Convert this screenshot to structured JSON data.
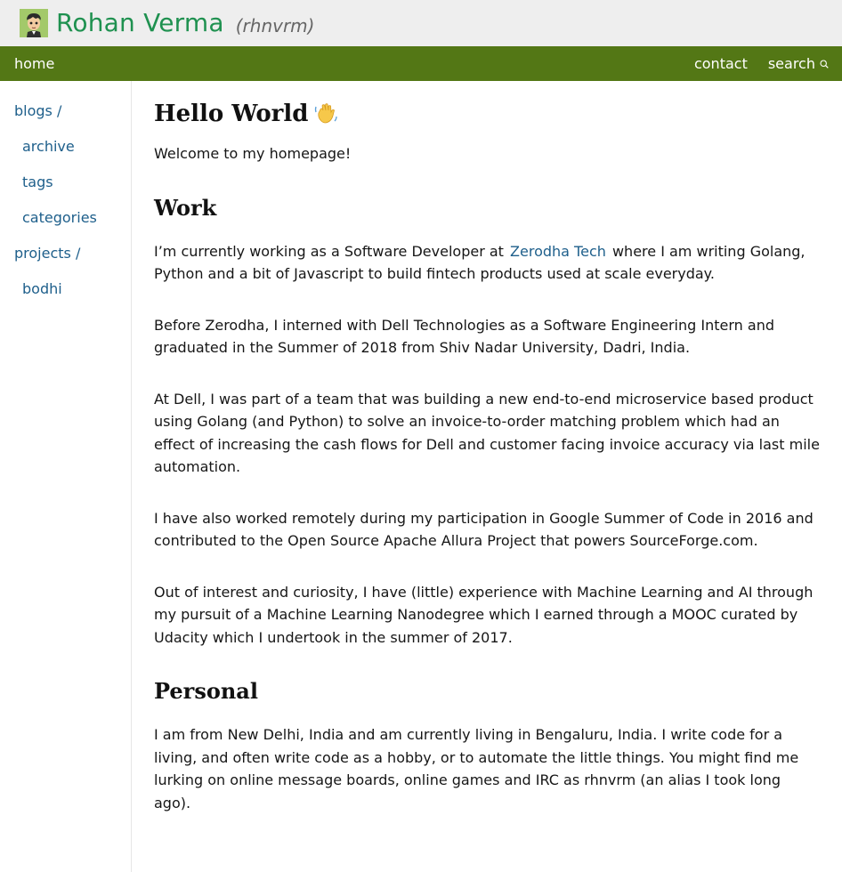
{
  "header": {
    "name": "Rohan Verma",
    "handle": "(rhnvrm)",
    "avatar_icon": "cartoon-avatar-icon"
  },
  "nav": {
    "home": "home",
    "contact": "contact",
    "search": "search",
    "search_icon": "search-icon",
    "bar_color": "#537715"
  },
  "sidebar": {
    "items": [
      {
        "label": "blogs /",
        "sub": false
      },
      {
        "label": "archive",
        "sub": true
      },
      {
        "label": "tags",
        "sub": true
      },
      {
        "label": "categories",
        "sub": true
      },
      {
        "label": "projects /",
        "sub": false
      },
      {
        "label": "bodhi",
        "sub": true
      }
    ]
  },
  "content": {
    "title": "Hello World",
    "title_icon": "waving-hand-icon",
    "welcome": "Welcome to my homepage!",
    "work_heading": "Work",
    "work_p1_before": "I’m currently working as a Software Developer at",
    "work_p1_link": "Zerodha Tech",
    "work_p1_after": "where I am writing Golang, Python and a bit of Javascript to build fintech products used at scale everyday.",
    "work_p2": "Before Zerodha, I interned with Dell Technologies as a Software Engineering Intern and graduated in the Summer of 2018 from Shiv Nadar University, Dadri, India.",
    "work_p3": "At Dell, I was part of a team that was building a new end-to-end microservice based product using Golang (and Python) to solve an invoice-to-order matching problem which had an effect of increasing the cash flows for Dell and customer facing invoice accuracy via last mile automation.",
    "work_p4": "I have also worked remotely during my participation in Google Summer of Code in 2016 and contributed to the Open Source Apache Allura Project that powers SourceForge.com.",
    "work_p5": "Out of interest and curiosity, I have (little) experience with Machine Learning and AI through my pursuit of a Machine Learning Nanodegree which I earned through a MOOC curated by Udacity which I undertook in the summer of 2017.",
    "personal_heading": "Personal",
    "personal_p1": "I am from New Delhi, India and am currently living in Bengaluru, India. I write code for a living, and often write code as a hobby, or to automate the little things. You might find me lurking on online message boards, online games and IRC as rhnvrm (an alias I took long ago)."
  }
}
